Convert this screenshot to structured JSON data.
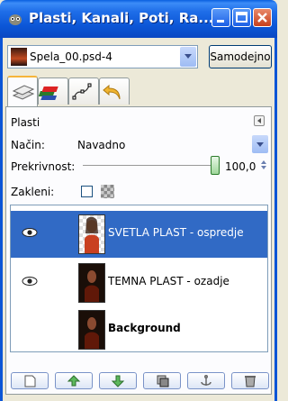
{
  "window": {
    "title": "Plasti, Kanali, Poti, Ra..."
  },
  "image_selector": {
    "value": "Spela_00.psd-4",
    "auto_label": "Samodejno"
  },
  "tabs": [
    {
      "name": "layers",
      "icon": "layers-icon",
      "active": true
    },
    {
      "name": "channels",
      "icon": "channels-icon",
      "active": false
    },
    {
      "name": "paths",
      "icon": "paths-icon",
      "active": false
    },
    {
      "name": "undo",
      "icon": "undo-icon",
      "active": false
    }
  ],
  "panel": {
    "title": "Plasti",
    "mode_label": "Način:",
    "mode_value": "Navadno",
    "opacity_label": "Prekrivnost:",
    "opacity_value": "100,0",
    "opacity_fraction": 1.0,
    "lock_label": "Zakleni:"
  },
  "layers": [
    {
      "name": "SVETLA PLAST - ospredje",
      "visible": true,
      "selected": true,
      "bold": false
    },
    {
      "name": "TEMNA PLAST - ozadje",
      "visible": true,
      "selected": false,
      "bold": false
    },
    {
      "name": "Background",
      "visible": false,
      "selected": false,
      "bold": true
    }
  ],
  "buttons": [
    "new-layer",
    "raise-layer",
    "lower-layer",
    "duplicate-layer",
    "anchor-layer",
    "delete-layer"
  ],
  "colors": {
    "title_bar": "#0b55d6",
    "selection": "#316ac5",
    "window_bg": "#ece9d8"
  }
}
